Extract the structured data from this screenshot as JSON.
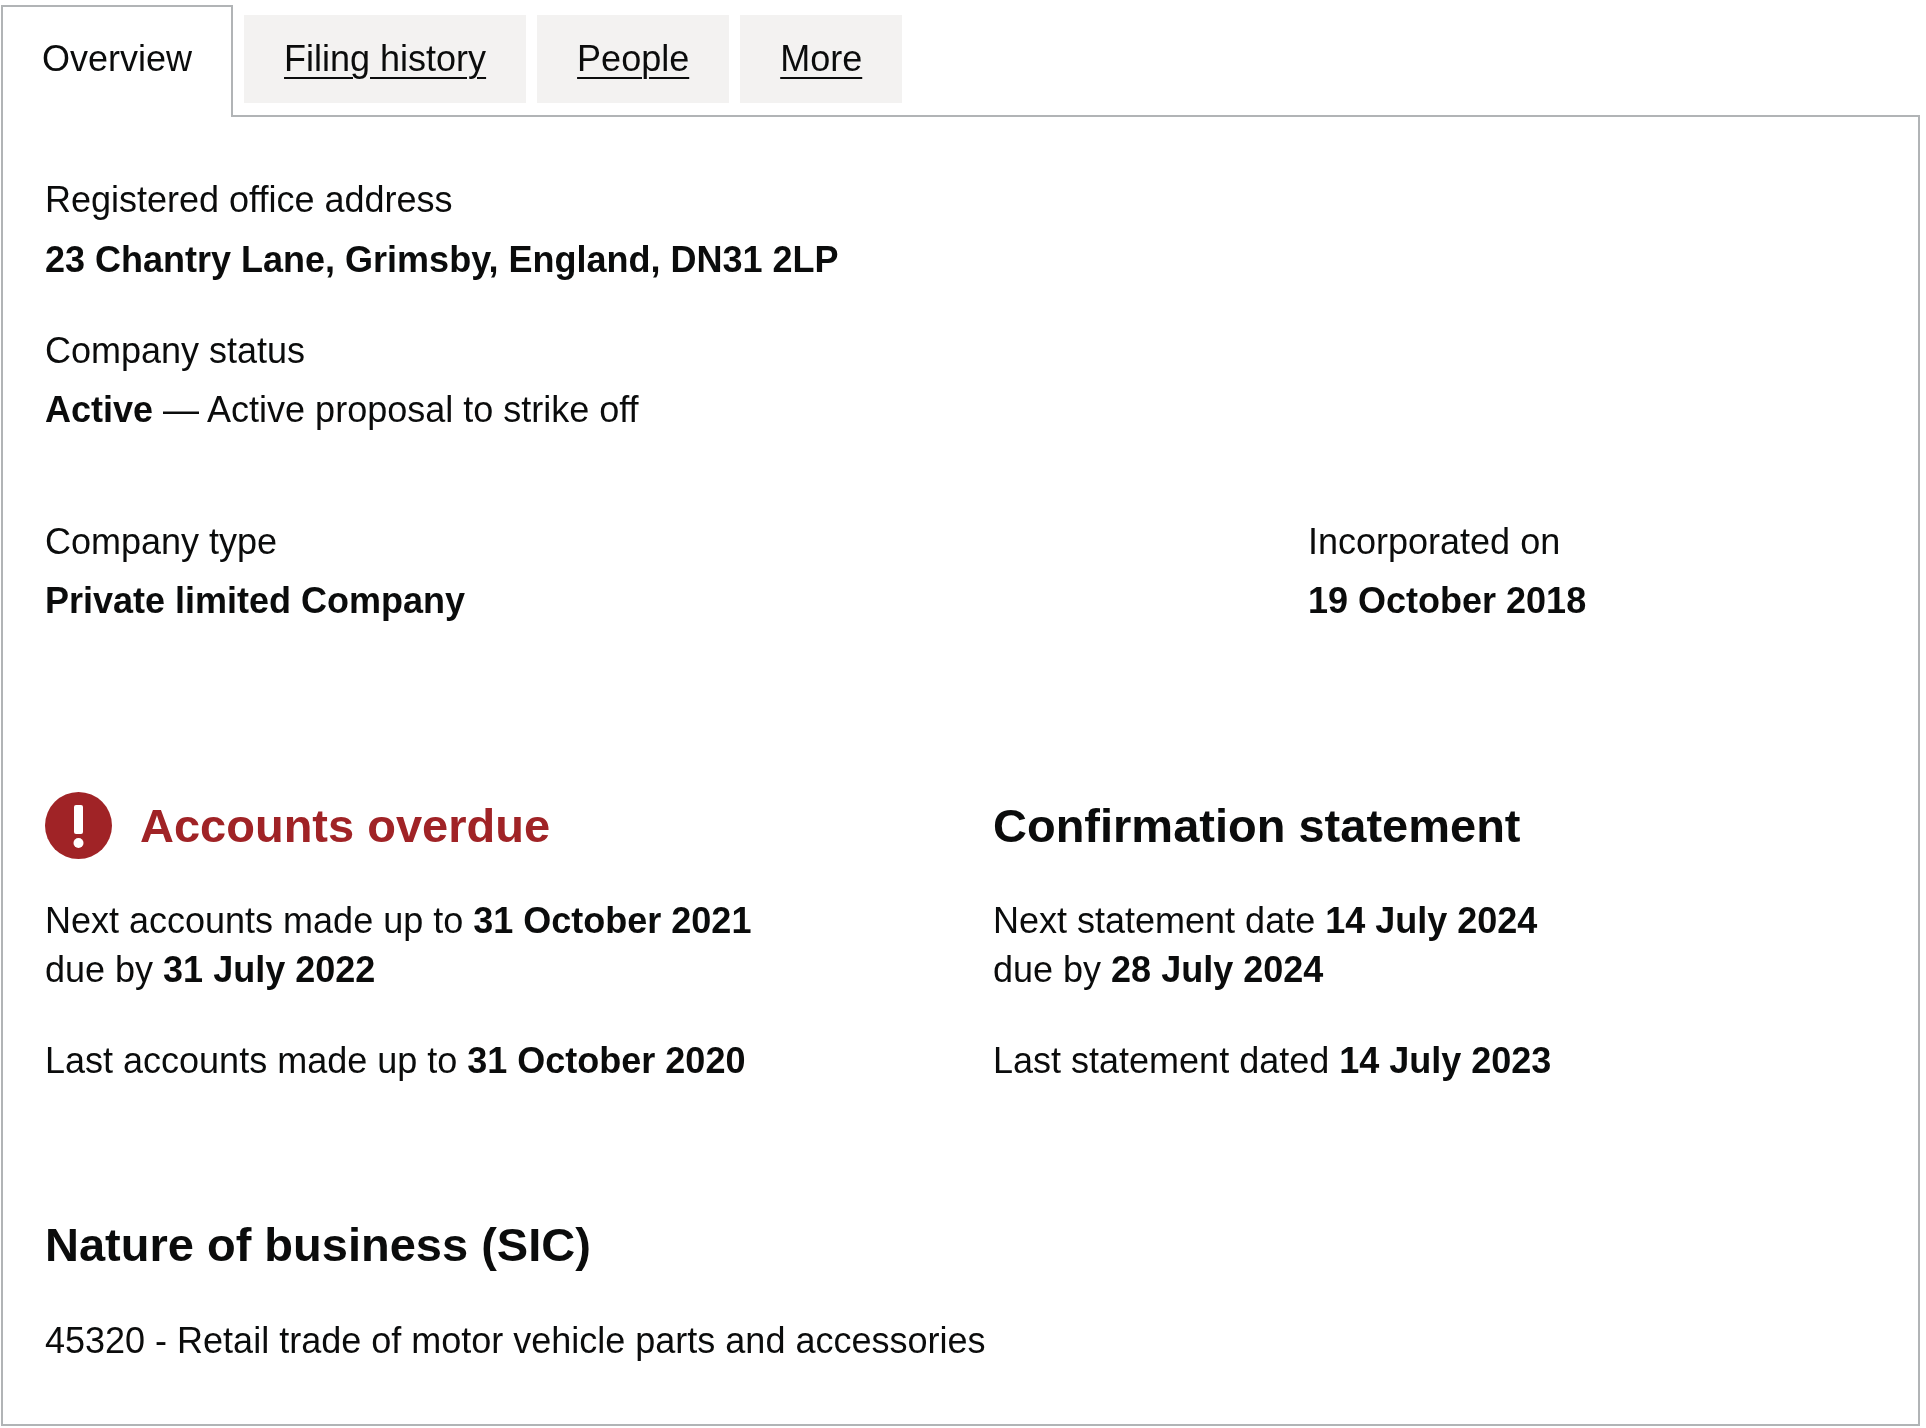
{
  "tabs": [
    {
      "label": "Overview",
      "selected": true
    },
    {
      "label": "Filing history",
      "selected": false
    },
    {
      "label": "People",
      "selected": false
    },
    {
      "label": "More",
      "selected": false
    }
  ],
  "registered_office": {
    "label": "Registered office address",
    "value": "23 Chantry Lane, Grimsby, England, DN31 2LP"
  },
  "company_status": {
    "label": "Company status",
    "value": "**Active** — Active proposal to strike off"
  },
  "company_type": {
    "label": "Company type",
    "value": "Private limited Company"
  },
  "incorporated": {
    "label": "Incorporated on",
    "value": "19 October 2018"
  },
  "accounts": {
    "title": "Accounts overdue",
    "overdue": true,
    "next": "Next accounts made up to **31 October 2021**",
    "due": "due by **31 July 2022**",
    "last": "Last accounts made up to **31 October 2020**"
  },
  "confirmation_statement": {
    "title": "Confirmation statement",
    "overdue": false,
    "next": "Next statement date **14 July 2024**",
    "due": "due by **28 July 2024**",
    "last": "Last statement dated **14 July 2023**"
  },
  "nature_of_business": {
    "title": "Nature of business (SIC)",
    "items": [
      "45320 - Retail trade of motor vehicle parts and accessories"
    ]
  }
}
